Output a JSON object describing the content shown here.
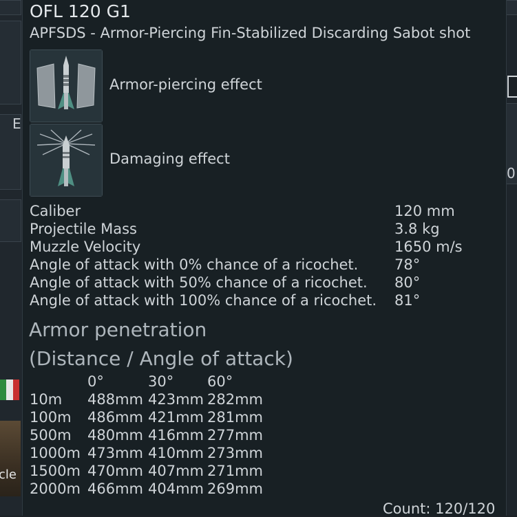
{
  "side": {
    "left_letter": "E",
    "left_bottom_text": "cle",
    "right_digit": "0"
  },
  "shell": {
    "name": "OFL 120 G1",
    "type_description": "APFSDS - Armor-Piercing Fin-Stabilized Discarding Sabot shot"
  },
  "effects": [
    {
      "icon": "armor-piercing-icon",
      "label": "Armor-piercing effect"
    },
    {
      "icon": "damaging-effect-icon",
      "label": "Damaging effect"
    }
  ],
  "stats": [
    {
      "label": "Caliber",
      "value": "120 mm"
    },
    {
      "label": "Projectile Mass",
      "value": "3.8 kg"
    },
    {
      "label": "Muzzle Velocity",
      "value": "1650 m/s"
    },
    {
      "label": "Angle of attack with 0% chance of a ricochet.",
      "value": "78°"
    },
    {
      "label": "Angle of attack with 50% chance of a ricochet.",
      "value": "80°"
    },
    {
      "label": "Angle of attack with 100% chance of a ricochet.",
      "value": "81°"
    }
  ],
  "penetration": {
    "title": "Armor penetration",
    "subtitle": "(Distance / Angle of attack)",
    "angles": [
      "0°",
      "30°",
      "60°"
    ],
    "rows": [
      {
        "distance": "10m",
        "values": [
          "488mm",
          "423mm",
          "282mm"
        ]
      },
      {
        "distance": "100m",
        "values": [
          "486mm",
          "421mm",
          "281mm"
        ]
      },
      {
        "distance": "500m",
        "values": [
          "480mm",
          "416mm",
          "277mm"
        ]
      },
      {
        "distance": "1000m",
        "values": [
          "473mm",
          "410mm",
          "273mm"
        ]
      },
      {
        "distance": "1500m",
        "values": [
          "470mm",
          "407mm",
          "271mm"
        ]
      },
      {
        "distance": "2000m",
        "values": [
          "466mm",
          "404mm",
          "269mm"
        ]
      }
    ]
  },
  "count": "Count: 120/120",
  "colors": {
    "panel_bg": "#182024",
    "text": "#cfd4d8",
    "heading": "#aeb6bc"
  }
}
